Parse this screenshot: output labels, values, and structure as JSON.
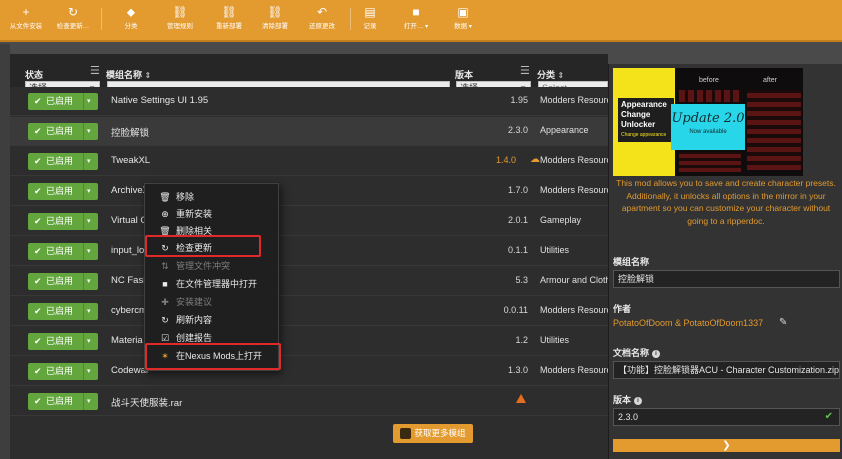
{
  "toolbar": {
    "items": [
      {
        "label": "从文件安装",
        "icon": "plus-icon"
      },
      {
        "label": "检查更新…",
        "icon": "refresh-icon"
      },
      {
        "label": "分类",
        "icon": "tag-icon"
      },
      {
        "label": "管理规则",
        "icon": "link-icon"
      },
      {
        "label": "重新部署",
        "icon": "link-icon"
      },
      {
        "label": "清除部署",
        "icon": "link-icon"
      },
      {
        "label": "还原更改",
        "icon": "undo-icon"
      },
      {
        "label": "记录",
        "icon": "document-icon"
      },
      {
        "label": "打开…",
        "icon": "folder-icon"
      },
      {
        "label": "数据",
        "icon": "save-icon"
      }
    ]
  },
  "table": {
    "headers": {
      "status": "状态",
      "name": "模组名称",
      "version": "版本",
      "category": "分类"
    },
    "filters": {
      "status": "选择",
      "version": "选择",
      "category": "Select..."
    },
    "enabled_label": "已启用",
    "rows": [
      {
        "name": "Native Settings UI 1.95",
        "version": "1.95",
        "category": "Modders Resources"
      },
      {
        "name": "控脸解锁",
        "version": "2.3.0",
        "category": "Appearance"
      },
      {
        "name": "TweakXL",
        "version": "1.4.0",
        "category": "Modders Resources"
      },
      {
        "name": "ArchiveXL",
        "version": "1.7.0",
        "category": "Modders Resources"
      },
      {
        "name": "Virtual C",
        "version": "2.0.1",
        "category": "Gameplay"
      },
      {
        "name": "input_lo",
        "version": "0.1.1",
        "category": "Utilities"
      },
      {
        "name": "NC Fash",
        "version": "5.3",
        "category": "Armour and Clothing"
      },
      {
        "name": "cybercm",
        "version": "0.0.11",
        "category": "Modders Resources"
      },
      {
        "name": "Materia",
        "version": "1.2",
        "category": "Utilities"
      },
      {
        "name": "Codewar",
        "version": "1.3.0",
        "category": "Modders Resources"
      },
      {
        "name": "战斗天使服装.rar",
        "version": "",
        "category": ""
      }
    ],
    "more_button": "获取更多模组"
  },
  "context_menu": {
    "items": [
      {
        "label": "移除",
        "icon": "trash-icon",
        "enabled": true
      },
      {
        "label": "重新安装",
        "icon": "reinstall-icon",
        "enabled": true
      },
      {
        "label": "删除相关",
        "icon": "trash-icon",
        "enabled": true
      },
      {
        "label": "检查更新",
        "icon": "refresh-icon",
        "enabled": true
      },
      {
        "label": "管理文件冲突",
        "icon": "conflict-icon",
        "enabled": false
      },
      {
        "label": "在文件管理器中打开",
        "icon": "folder-icon",
        "enabled": true
      },
      {
        "label": "安装建议",
        "icon": "plus-icon",
        "enabled": false
      },
      {
        "label": "刷新内容",
        "icon": "refresh-icon",
        "enabled": true
      },
      {
        "label": "创建报告",
        "icon": "report-icon",
        "enabled": true
      },
      {
        "label": "在Nexus Mods上打开",
        "icon": "nexus-icon",
        "enabled": true
      }
    ]
  },
  "detail": {
    "banner": {
      "title_lines": [
        "Appearance",
        "Change",
        "Unlocker"
      ],
      "title_sub": "Change appearance",
      "update_text": "Update 2.0",
      "update_sub": "Now available",
      "before": "before",
      "after": "after"
    },
    "description": "This mod allows you to save and create character presets. Additionally, it unlocks all options in the mirror in your apartment so you can customize your character without going to a ripperdoc.",
    "mod_name_label": "模组名称",
    "mod_name_value": "控脸解锁",
    "author_label": "作者",
    "author_value": "PotatoOfDoom & PotatoOfDoom1337",
    "archive_label": "文档名称",
    "archive_value": "【功能】控脸解锁器ACU - Character Customization.zip",
    "version_label": "版本",
    "version_value": "2.3.0"
  },
  "colors": {
    "accent": "#e39a2f",
    "enabled": "#63a63d",
    "highlight": "#e02a2a"
  }
}
